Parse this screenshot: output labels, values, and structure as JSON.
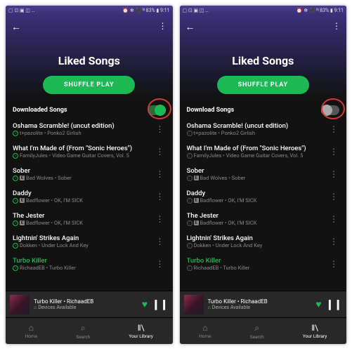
{
  "statusbar": {
    "left": "▢ ⊡ ▣ ◫ …",
    "right": "⏰ ✻ ⚫ ᴺ 83% ▮ 9:11"
  },
  "page": {
    "title": "Liked Songs",
    "shuffle": "SHUFFLE PLAY",
    "download_on": "Downloaded Songs",
    "download_off": "Download Songs"
  },
  "songs": [
    {
      "title": "Oshama Scramble! (uncut edition)",
      "sub": "t+pazolite • Ponko2 Girlish",
      "e": false
    },
    {
      "title": "What I'm Made of (From \"Sonic Heroes\")",
      "sub": "FamilyJules • Video Game Guitar Covers, Vol. 5",
      "e": false
    },
    {
      "title": "Sober",
      "sub": "Bad Wolves • Sober",
      "e": true
    },
    {
      "title": "Daddy",
      "sub": "Badflower • OK, I'M SICK",
      "e": true
    },
    {
      "title": "The Jester",
      "sub": "Badflower • OK, I'M SICK",
      "e": true
    },
    {
      "title": "Lightnin' Strikes Again",
      "sub": "Dokken • Under Lock And Key",
      "e": false
    },
    {
      "title": "Turbo Killer",
      "sub": "RichaadEB • Turbo Killer",
      "e": false,
      "playing": true
    }
  ],
  "nowplaying": {
    "title": "Turbo Killer",
    "artist": "RichaadEB",
    "devices": "Devices Available"
  },
  "nav": {
    "home": "Home",
    "search": "Search",
    "library": "Your Library"
  }
}
